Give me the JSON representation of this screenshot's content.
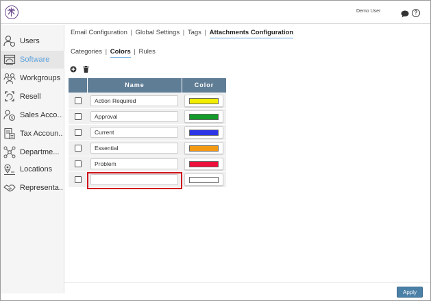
{
  "header": {
    "user_name": "Demo User"
  },
  "sidebar": {
    "items": [
      {
        "label": "Users",
        "icon": "users-icon",
        "active": false
      },
      {
        "label": "Software",
        "icon": "software-icon",
        "active": true
      },
      {
        "label": "Workgroups",
        "icon": "workgroups-icon",
        "active": false
      },
      {
        "label": "Resell",
        "icon": "resell-icon",
        "active": false
      },
      {
        "label": "Sales Acco...",
        "icon": "sales-accounts-icon",
        "active": false
      },
      {
        "label": "Tax Accoun...",
        "icon": "tax-accounts-icon",
        "active": false
      },
      {
        "label": "Departme...",
        "icon": "departments-icon",
        "active": false
      },
      {
        "label": "Locations",
        "icon": "locations-icon",
        "active": false
      },
      {
        "label": "Representa...",
        "icon": "representatives-icon",
        "active": false
      }
    ]
  },
  "main_tabs": [
    {
      "label": "Email Configuration"
    },
    {
      "label": "Global Settings"
    },
    {
      "label": "Tags"
    },
    {
      "label": "Attachments Configuration",
      "active": true
    }
  ],
  "sub_tabs": [
    {
      "label": "Categories"
    },
    {
      "label": "Colors",
      "active": true
    },
    {
      "label": "Rules"
    }
  ],
  "table": {
    "columns": [
      "Name",
      "Color"
    ],
    "rows": [
      {
        "name": "Action Required",
        "color": "#f2ee00"
      },
      {
        "name": "Approval",
        "color": "#149c2a"
      },
      {
        "name": "Current",
        "color": "#2c36e8"
      },
      {
        "name": "Essential",
        "color": "#f59a10"
      },
      {
        "name": "Problem",
        "color": "#ee0f3a"
      },
      {
        "name": "",
        "color": "#ffffff"
      }
    ]
  },
  "footer": {
    "apply_label": "Apply"
  },
  "colors": {
    "accent": "#5aa0dc",
    "table_header": "#607d96",
    "apply_button": "#4a7fa6",
    "highlight": "#d0101a"
  }
}
